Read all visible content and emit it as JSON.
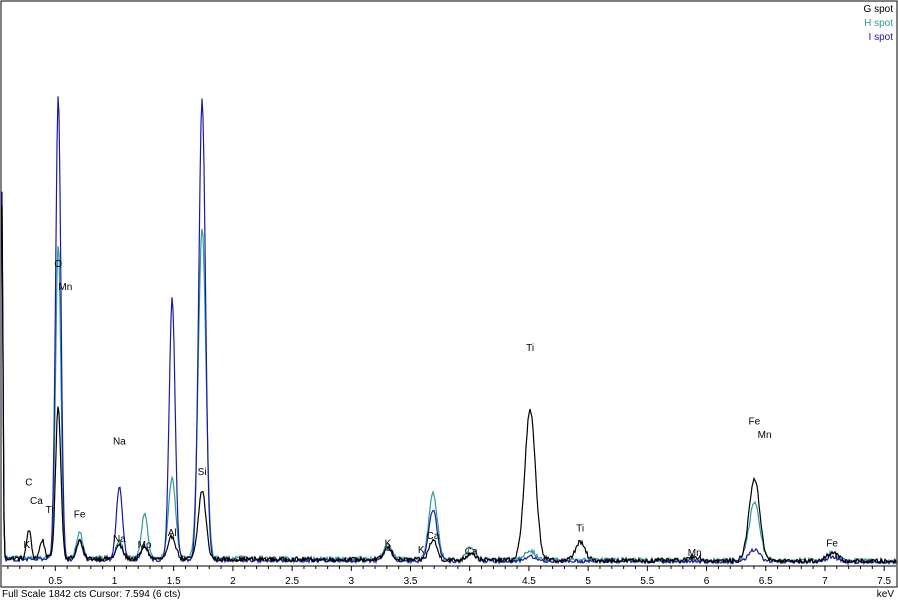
{
  "chart_data": {
    "type": "line",
    "title": "",
    "xlabel": "keV",
    "ylabel": "",
    "xlim": [
      0.05,
      7.6
    ],
    "ylim": [
      0,
      1842
    ],
    "grid": false,
    "legend_position": "top-right",
    "x_ticks": [
      "0.5",
      "1",
      "1.5",
      "2",
      "2.5",
      "3",
      "3.5",
      "4",
      "4.5",
      "5",
      "5.5",
      "6",
      "6.5",
      "7",
      "7.5"
    ],
    "series": [
      {
        "name": "G spot",
        "color": "#000000",
        "baseline": 22,
        "noise": 8,
        "peaks": [
          {
            "x": 0.05,
            "h": 1150,
            "w": 0.008
          },
          {
            "x": 0.277,
            "h": 95,
            "w": 0.018
          },
          {
            "x": 0.39,
            "h": 60,
            "w": 0.02
          },
          {
            "x": 0.525,
            "h": 500,
            "w": 0.022
          },
          {
            "x": 0.705,
            "h": 60,
            "w": 0.025
          },
          {
            "x": 1.041,
            "h": 45,
            "w": 0.028
          },
          {
            "x": 1.254,
            "h": 40,
            "w": 0.028
          },
          {
            "x": 1.487,
            "h": 75,
            "w": 0.03
          },
          {
            "x": 1.74,
            "h": 225,
            "w": 0.032
          },
          {
            "x": 3.31,
            "h": 40,
            "w": 0.033
          },
          {
            "x": 3.69,
            "h": 65,
            "w": 0.033
          },
          {
            "x": 4.012,
            "h": 25,
            "w": 0.035
          },
          {
            "x": 4.51,
            "h": 490,
            "w": 0.045
          },
          {
            "x": 4.932,
            "h": 60,
            "w": 0.04
          },
          {
            "x": 5.9,
            "h": 15,
            "w": 0.04
          },
          {
            "x": 6.404,
            "h": 270,
            "w": 0.045
          },
          {
            "x": 7.06,
            "h": 30,
            "w": 0.045
          }
        ]
      },
      {
        "name": "H spot",
        "color": "#2e9a9a",
        "baseline": 24,
        "noise": 7,
        "peaks": [
          {
            "x": 0.05,
            "h": 1100,
            "w": 0.008
          },
          {
            "x": 0.525,
            "h": 1030,
            "w": 0.022
          },
          {
            "x": 0.705,
            "h": 85,
            "w": 0.025
          },
          {
            "x": 1.041,
            "h": 55,
            "w": 0.028
          },
          {
            "x": 1.254,
            "h": 150,
            "w": 0.026
          },
          {
            "x": 1.487,
            "h": 265,
            "w": 0.03
          },
          {
            "x": 1.74,
            "h": 1080,
            "w": 0.032
          },
          {
            "x": 3.31,
            "h": 50,
            "w": 0.033
          },
          {
            "x": 3.69,
            "h": 220,
            "w": 0.035
          },
          {
            "x": 4.012,
            "h": 40,
            "w": 0.035
          },
          {
            "x": 4.51,
            "h": 30,
            "w": 0.045
          },
          {
            "x": 6.404,
            "h": 190,
            "w": 0.045
          },
          {
            "x": 7.06,
            "h": 25,
            "w": 0.045
          }
        ]
      },
      {
        "name": "I spot",
        "color": "#1a1aa0",
        "baseline": 18,
        "noise": 6,
        "peaks": [
          {
            "x": 0.05,
            "h": 1200,
            "w": 0.008
          },
          {
            "x": 0.525,
            "h": 1520,
            "w": 0.022
          },
          {
            "x": 0.705,
            "h": 65,
            "w": 0.025
          },
          {
            "x": 1.041,
            "h": 240,
            "w": 0.026
          },
          {
            "x": 1.254,
            "h": 45,
            "w": 0.028
          },
          {
            "x": 1.487,
            "h": 855,
            "w": 0.025
          },
          {
            "x": 1.74,
            "h": 1510,
            "w": 0.028
          },
          {
            "x": 3.31,
            "h": 40,
            "w": 0.033
          },
          {
            "x": 3.69,
            "h": 165,
            "w": 0.035
          },
          {
            "x": 4.012,
            "h": 25,
            "w": 0.035
          },
          {
            "x": 4.51,
            "h": 15,
            "w": 0.045
          },
          {
            "x": 6.404,
            "h": 40,
            "w": 0.045
          },
          {
            "x": 7.06,
            "h": 18,
            "w": 0.045
          }
        ]
      }
    ],
    "peak_labels": [
      {
        "text": "C",
        "x": 0.277,
        "y": 260
      },
      {
        "text": "Ca",
        "x": 0.341,
        "y": 200
      },
      {
        "text": "K",
        "x": 0.26,
        "y": 55
      },
      {
        "text": "Ti",
        "x": 0.452,
        "y": 170
      },
      {
        "text": "O",
        "x": 0.525,
        "y": 975
      },
      {
        "text": "Mn",
        "x": 0.585,
        "y": 900
      },
      {
        "text": "Fe",
        "x": 0.705,
        "y": 155
      },
      {
        "text": "Na",
        "x": 1.041,
        "y": 395
      },
      {
        "text": "Na",
        "x": 1.041,
        "y": 75
      },
      {
        "text": "Mo",
        "x": 1.254,
        "y": 55
      },
      {
        "text": "Al",
        "x": 1.487,
        "y": 95
      },
      {
        "text": "Si",
        "x": 1.74,
        "y": 295
      },
      {
        "text": "K",
        "x": 3.31,
        "y": 60
      },
      {
        "text": "K",
        "x": 3.59,
        "y": 40
      },
      {
        "text": "Ca",
        "x": 3.69,
        "y": 85
      },
      {
        "text": "Ca",
        "x": 4.012,
        "y": 35
      },
      {
        "text": "Ti",
        "x": 4.51,
        "y": 700
      },
      {
        "text": "Ti",
        "x": 4.932,
        "y": 110
      },
      {
        "text": "Mn",
        "x": 5.9,
        "y": 30
      },
      {
        "text": "Fe",
        "x": 6.404,
        "y": 460
      },
      {
        "text": "Mn",
        "x": 6.49,
        "y": 415
      },
      {
        "text": "Fe",
        "x": 7.06,
        "y": 60
      }
    ]
  },
  "status": {
    "full_scale_text": "Full Scale 1842 cts Cursor: 7.594  (6 cts)",
    "unit_label": "keV"
  }
}
